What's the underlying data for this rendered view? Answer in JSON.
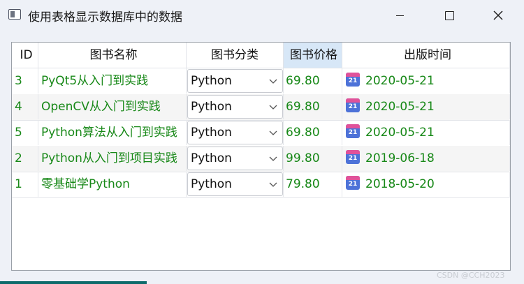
{
  "window": {
    "title": "使用表格显示数据库中的数据",
    "icon": "window-app-icon",
    "buttons": [
      "minimize",
      "maximize",
      "close"
    ]
  },
  "table": {
    "headers": [
      "ID",
      "图书名称",
      "图书分类",
      "图书价格",
      "出版时间"
    ],
    "selected_header": "图书价格",
    "text_color": "#178817",
    "rows": [
      {
        "id": "3",
        "name": "PyQt5从入门到实践",
        "category": "Python",
        "price": "69.80",
        "date": "2020-05-21"
      },
      {
        "id": "4",
        "name": "OpenCV从入门到实践",
        "category": "Python",
        "price": "69.80",
        "date": "2020-05-21"
      },
      {
        "id": "5",
        "name": "Python算法从入门到实践",
        "category": "Python",
        "price": "69.80",
        "date": "2020-05-21"
      },
      {
        "id": "2",
        "name": "Python从入门到项目实践",
        "category": "Python",
        "price": "99.80",
        "date": "2019-06-18"
      },
      {
        "id": "1",
        "name": "零基础学Python",
        "category": "Python",
        "price": "79.80",
        "date": "2018-05-20"
      }
    ],
    "calendar_icon_label": "21"
  },
  "watermark": "CSDN @CCH2023"
}
